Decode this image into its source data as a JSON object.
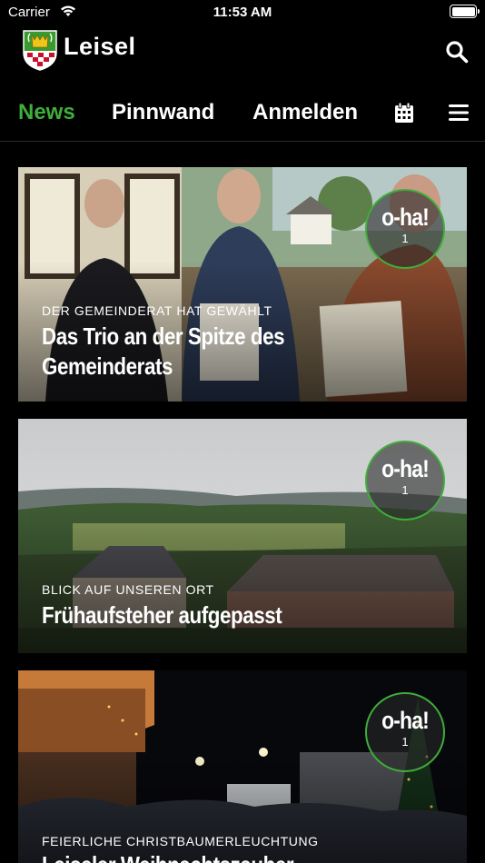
{
  "status_bar": {
    "carrier": "Carrier",
    "time": "11:53 AM"
  },
  "header": {
    "title": "Leisel"
  },
  "nav": {
    "tabs": [
      {
        "label": "News"
      },
      {
        "label": "Pinnwand"
      },
      {
        "label": "Anmelden"
      }
    ]
  },
  "cards": [
    {
      "kicker": "DER GEMEINDERAT HAT GEWÄHLT",
      "title": "Das Trio an der Spitze des Gemeinderats",
      "badge": {
        "label": "o-ha!",
        "count": "1"
      }
    },
    {
      "kicker": "BLICK AUF UNSEREN ORT",
      "title": "Frühaufsteher aufgepasst",
      "badge": {
        "label": "o-ha!",
        "count": "1"
      }
    },
    {
      "kicker": "FEIERLICHE CHRISTBAUMERLEUCHTUNG",
      "title": "Leiseler Weihnachtszauber",
      "badge": {
        "label": "o-ha!",
        "count": "1"
      }
    }
  ],
  "colors": {
    "accent": "#3fae3a",
    "background": "#000000"
  },
  "icons": [
    "wifi-icon",
    "battery-icon",
    "coat-of-arms-logo",
    "search-icon",
    "calendar-icon",
    "menu-icon"
  ]
}
